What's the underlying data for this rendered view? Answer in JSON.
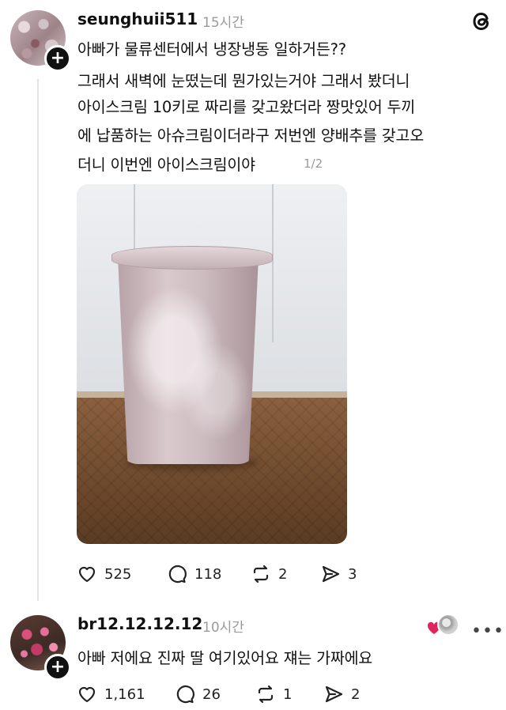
{
  "app": {
    "logo_icon": "threads-icon"
  },
  "post": {
    "username": "seunghuii511",
    "time": "15시간",
    "lines": [
      "아빠가 물류센터에서 냉장냉동 일하거든??",
      "그래서 새벽에 눈떴는데 뭔가있는거야 그래서 봤더니",
      "아이스크림 10키로 짜리를 갖고왔더라 짱맛있어 두끼",
      "에 납품하는 아슈크림이더라구 저번엔 양배추를 갖고오",
      "더니 이번엔 아이스크림이야"
    ],
    "page_indicator": "1/2",
    "photo_alt_icon": "photo",
    "actions": {
      "likes": "525",
      "comments": "118",
      "reposts": "2",
      "shares": "3"
    }
  },
  "reply": {
    "username": "br12.12.12.12",
    "time": "10시간",
    "text": "아빠 저에요 진짜 딸 여기있어요 쟤는 가짜에요",
    "actions": {
      "likes": "1,161",
      "comments": "26",
      "reposts": "1",
      "shares": "2"
    },
    "liked_color": "#e0245e"
  }
}
